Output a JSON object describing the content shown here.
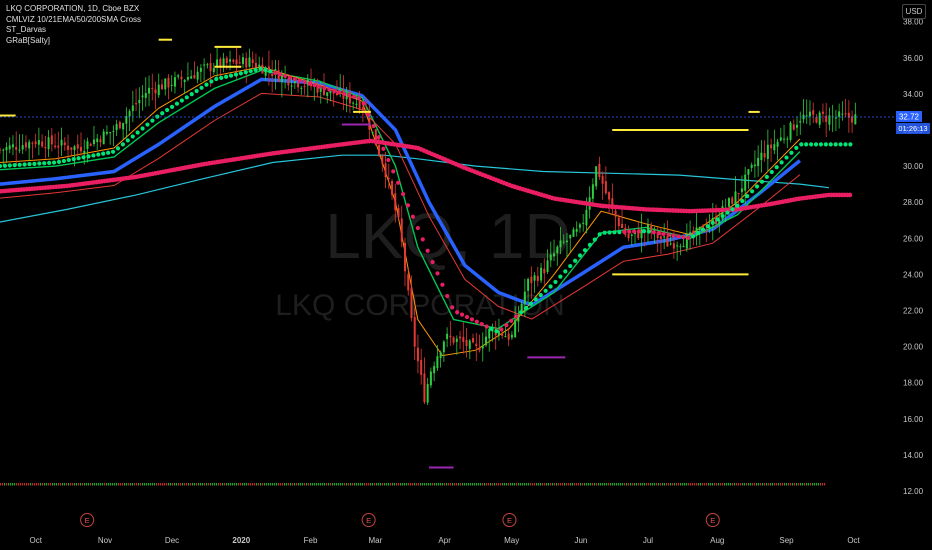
{
  "legend": {
    "title": "LKQ CORPORATION, 1D, Cboe BZX",
    "ind1": "CMLVIZ 10/21EMA/50/200SMA Cross",
    "ind2": "ST_Darvas",
    "ind3": "GRaB[Salty]"
  },
  "currency": "USD",
  "watermark": {
    "symbol": "LKQ, 1D",
    "name": "LKQ CORPORATION"
  },
  "price_label": "32.72",
  "countdown_label": "01:26:13",
  "earnings_marker": "E",
  "colors": {
    "up": "#26a69a",
    "down": "#ef5350",
    "green_bar": "#2ecc40",
    "red_bar": "#e53935",
    "ema10": "#ff9800",
    "ema21": "#00c853",
    "sma50": "#2962ff",
    "sma200": "#26c6da",
    "grab_up": "#00e676",
    "grab_down": "#e91e63",
    "slow_ma": "#d81b60",
    "darvas_yellow": "#ffeb3b",
    "darvas_purple": "#9c27b0",
    "price_line": "#2962ff"
  },
  "chart_data": {
    "type": "line",
    "title": "LKQ CORPORATION, 1D, Cboe BZX",
    "xlabel": "",
    "ylabel": "",
    "ylim": [
      11.5,
      39.2
    ],
    "y_ticks": [
      12.0,
      14.0,
      16.0,
      18.0,
      20.0,
      22.0,
      24.0,
      26.0,
      28.0,
      30.0,
      32.0,
      34.0,
      36.0,
      38.0
    ],
    "y_tick_labels": [
      "12.00",
      "14.00",
      "16.00",
      "18.00",
      "20.00",
      "22.00",
      "24.00",
      "26.00",
      "28.00",
      "30.00",
      "32.00",
      "34.00",
      "36.00",
      "38.00"
    ],
    "x_ticks": [
      "Oct",
      "Nov",
      "Dec",
      "2020",
      "Feb",
      "Mar",
      "Apr",
      "May",
      "Jun",
      "Jul",
      "Aug",
      "Sep",
      "Oct"
    ],
    "x_tick_dates": [
      "2019-10-01",
      "2019-11-01",
      "2019-12-01",
      "2020-01-01",
      "2020-02-01",
      "2020-03-01",
      "2020-04-01",
      "2020-05-01",
      "2020-06-01",
      "2020-07-01",
      "2020-08-01",
      "2020-09-01",
      "2020-10-01"
    ],
    "xlim": [
      "2019-09-15",
      "2020-10-20"
    ],
    "last_price": 32.72,
    "earnings_dates": [
      "2019-10-24",
      "2020-02-27",
      "2020-04-30",
      "2020-07-30"
    ],
    "series": [
      {
        "name": "Price",
        "x": [
          "2019-09-15",
          "2019-10-01",
          "2019-10-20",
          "2019-11-05",
          "2019-11-20",
          "2019-12-05",
          "2019-12-20",
          "2020-01-05",
          "2020-01-20",
          "2020-02-05",
          "2020-02-15",
          "2020-02-24",
          "2020-03-05",
          "2020-03-12",
          "2020-03-18",
          "2020-03-23",
          "2020-03-26",
          "2020-04-01",
          "2020-04-08",
          "2020-04-15",
          "2020-04-22",
          "2020-05-01",
          "2020-05-08",
          "2020-05-15",
          "2020-05-22",
          "2020-06-01",
          "2020-06-08",
          "2020-06-15",
          "2020-06-22",
          "2020-07-01",
          "2020-07-10",
          "2020-07-20",
          "2020-07-31",
          "2020-08-10",
          "2020-08-20",
          "2020-09-01",
          "2020-09-07"
        ],
        "values": [
          30.9,
          31.4,
          31.0,
          32.0,
          34.2,
          34.8,
          35.6,
          35.8,
          34.9,
          34.3,
          33.9,
          33.4,
          30.0,
          26.5,
          20.5,
          17.2,
          18.8,
          20.5,
          20.3,
          19.8,
          21.0,
          20.5,
          23.5,
          24.2,
          25.5,
          26.5,
          30.0,
          27.5,
          26.0,
          26.5,
          25.7,
          26.0,
          27.0,
          28.5,
          30.5,
          31.8,
          32.7
        ]
      },
      {
        "name": "10EMA",
        "x": [
          "2019-09-15",
          "2019-10-10",
          "2019-11-05",
          "2019-11-25",
          "2019-12-20",
          "2020-01-10",
          "2020-02-05",
          "2020-02-24",
          "2020-03-10",
          "2020-03-20",
          "2020-03-31",
          "2020-04-15",
          "2020-04-30",
          "2020-05-20",
          "2020-06-10",
          "2020-06-30",
          "2020-07-20",
          "2020-08-10",
          "2020-09-07"
        ],
        "values": [
          30.2,
          30.4,
          31.0,
          33.2,
          35.0,
          35.5,
          34.5,
          33.6,
          28.0,
          21.5,
          19.5,
          19.8,
          21.0,
          24.0,
          27.5,
          26.8,
          26.2,
          28.0,
          31.5
        ]
      },
      {
        "name": "21EMA",
        "x": [
          "2019-09-15",
          "2019-10-10",
          "2019-11-05",
          "2019-11-25",
          "2019-12-20",
          "2020-01-10",
          "2020-02-05",
          "2020-02-24",
          "2020-03-10",
          "2020-03-20",
          "2020-04-05",
          "2020-04-25",
          "2020-05-20",
          "2020-06-10",
          "2020-06-30",
          "2020-07-20",
          "2020-08-10",
          "2020-09-07"
        ],
        "values": [
          29.8,
          30.0,
          30.5,
          32.4,
          34.3,
          35.3,
          34.7,
          33.8,
          30.0,
          25.5,
          21.5,
          21.0,
          23.0,
          26.3,
          26.6,
          26.0,
          27.3,
          30.8
        ]
      },
      {
        "name": "50SMA",
        "x": [
          "2019-09-15",
          "2019-10-10",
          "2019-11-05",
          "2019-11-25",
          "2019-12-20",
          "2020-01-10",
          "2020-02-05",
          "2020-02-24",
          "2020-03-10",
          "2020-03-25",
          "2020-04-10",
          "2020-04-25",
          "2020-05-10",
          "2020-06-01",
          "2020-06-20",
          "2020-07-10",
          "2020-07-30",
          "2020-08-20",
          "2020-09-07"
        ],
        "values": [
          29.0,
          29.3,
          29.7,
          31.2,
          33.3,
          34.8,
          34.6,
          33.9,
          32.0,
          28.0,
          24.5,
          23.0,
          22.3,
          24.0,
          25.5,
          25.9,
          26.5,
          28.5,
          30.3
        ]
      },
      {
        "name": "200SMA",
        "x": [
          "2019-09-15",
          "2019-10-15",
          "2019-11-15",
          "2019-12-15",
          "2020-01-15",
          "2020-02-15",
          "2020-03-05",
          "2020-03-20",
          "2020-04-15",
          "2020-05-15",
          "2020-06-15",
          "2020-07-15",
          "2020-08-15",
          "2020-09-07",
          "2020-09-20"
        ],
        "values": [
          26.9,
          27.6,
          28.4,
          29.3,
          30.2,
          30.6,
          30.6,
          30.4,
          30.0,
          29.7,
          29.6,
          29.5,
          29.2,
          29.0,
          28.8
        ]
      },
      {
        "name": "GRaB trend dots",
        "x": [
          "2019-09-15",
          "2019-10-10",
          "2019-11-05",
          "2019-11-25",
          "2019-12-20",
          "2020-01-10",
          "2020-02-05",
          "2020-02-24",
          "2020-04-05",
          "2020-04-25",
          "2020-05-20",
          "2020-06-10",
          "2020-06-30",
          "2020-07-20",
          "2020-08-10",
          "2020-09-07"
        ],
        "values": [
          30.0,
          30.2,
          30.8,
          32.8,
          34.8,
          35.4,
          34.4,
          33.7,
          22.0,
          20.8,
          23.5,
          26.3,
          26.4,
          26.0,
          27.8,
          31.2
        ]
      },
      {
        "name": "Slow MA dots",
        "x": [
          "2019-09-15",
          "2019-10-15",
          "2019-11-15",
          "2019-12-15",
          "2020-01-15",
          "2020-02-15",
          "2020-02-28",
          "2020-03-20",
          "2020-04-10",
          "2020-05-01",
          "2020-05-20",
          "2020-06-10",
          "2020-06-30",
          "2020-07-20",
          "2020-08-10",
          "2020-08-25",
          "2020-09-07",
          "2020-09-20"
        ],
        "values": [
          28.6,
          28.9,
          29.4,
          30.1,
          30.7,
          31.2,
          31.4,
          31.0,
          29.9,
          28.9,
          28.2,
          27.8,
          27.6,
          27.5,
          27.6,
          27.9,
          28.2,
          28.4
        ]
      }
    ],
    "darvas_yellow": [
      {
        "start": "2019-09-15",
        "end": "2019-09-22",
        "value": 32.8
      },
      {
        "start": "2019-11-25",
        "end": "2019-12-01",
        "value": 37.0
      },
      {
        "start": "2019-12-20",
        "end": "2020-01-01",
        "value": 36.6
      },
      {
        "start": "2019-12-20",
        "end": "2020-01-01",
        "value": 35.5
      },
      {
        "start": "2020-02-20",
        "end": "2020-02-28",
        "value": 33.0
      },
      {
        "start": "2020-06-15",
        "end": "2020-08-15",
        "value": 32.0
      },
      {
        "start": "2020-06-15",
        "end": "2020-08-15",
        "value": 24.0
      },
      {
        "start": "2020-08-15",
        "end": "2020-08-20",
        "value": 33.0
      }
    ],
    "darvas_purple": [
      {
        "start": "2020-02-15",
        "end": "2020-02-28",
        "value": 32.3
      },
      {
        "start": "2020-03-25",
        "end": "2020-04-05",
        "value": 13.3
      },
      {
        "start": "2020-05-08",
        "end": "2020-05-25",
        "value": 19.4
      }
    ]
  }
}
